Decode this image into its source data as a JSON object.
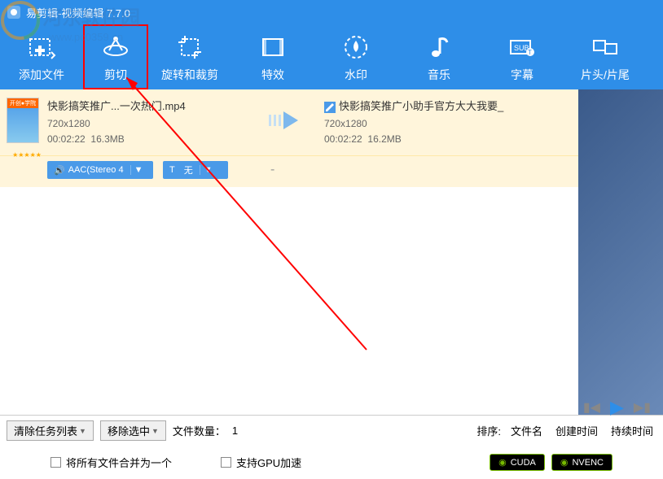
{
  "app_title": "易剪辑-视频编辑 7.7.0",
  "watermark_text": "河东软件园",
  "watermark_url": "www.pc0359.cn",
  "toolbar": [
    {
      "id": "add-file",
      "label": "添加文件",
      "icon": "add"
    },
    {
      "id": "cut",
      "label": "剪切",
      "icon": "cut",
      "highlighted": true
    },
    {
      "id": "rotate-crop",
      "label": "旋转和裁剪",
      "icon": "crop"
    },
    {
      "id": "effects",
      "label": "特效",
      "icon": "film"
    },
    {
      "id": "watermark",
      "label": "水印",
      "icon": "drop"
    },
    {
      "id": "music",
      "label": "音乐",
      "icon": "note"
    },
    {
      "id": "subtitle",
      "label": "字幕",
      "icon": "sub"
    },
    {
      "id": "intro-outro",
      "label": "片头/片尾",
      "icon": "clips"
    }
  ],
  "file": {
    "input_name": "快影搞笑推广...一次热门.mp4",
    "input_res": "720x1280",
    "input_duration": "00:02:22",
    "input_size": "16.3MB",
    "output_name": "快影搞笑推广小助手官方大大我要_",
    "output_res": "720x1280",
    "output_duration": "00:02:22",
    "output_size": "16.2MB",
    "thumb_label": "开创●学院",
    "audio_codec": "AAC(Stereo 4",
    "subtitle_sel": "无",
    "dash": "-"
  },
  "bottom": {
    "clear_list": "清除任务列表",
    "remove_sel": "移除选中",
    "file_count_label": "文件数量：",
    "file_count": "1",
    "sort_label": "排序:",
    "sort_name": "文件名",
    "sort_created": "创建时间",
    "sort_duration": "持续时间"
  },
  "options": {
    "merge_all": "将所有文件合并为一个",
    "gpu_accel": "支持GPU加速",
    "cuda": "CUDA",
    "nvenc": "NVENC"
  }
}
